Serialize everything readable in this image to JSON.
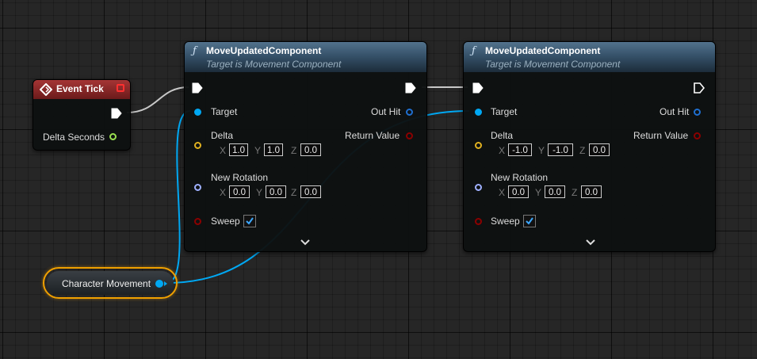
{
  "event_tick": {
    "title": "Event Tick",
    "output_label": "Delta Seconds"
  },
  "variable_node": {
    "label": "Character Movement"
  },
  "function_nodes": [
    {
      "title": "MoveUpdatedComponent",
      "subtitle": "Target is Movement Component",
      "target_label": "Target",
      "out_hit_label": "Out Hit",
      "return_label": "Return Value",
      "delta_label": "Delta",
      "delta": {
        "x": "1.0",
        "y": "1.0",
        "z": "0.0"
      },
      "rotation_label": "New Rotation",
      "rotation": {
        "x": "0.0",
        "y": "0.0",
        "z": "0.0"
      },
      "sweep_label": "Sweep",
      "sweep_checked": true
    },
    {
      "title": "MoveUpdatedComponent",
      "subtitle": "Target is Movement Component",
      "target_label": "Target",
      "out_hit_label": "Out Hit",
      "return_label": "Return Value",
      "delta_label": "Delta",
      "delta": {
        "x": "-1.0",
        "y": "-1.0",
        "z": "0.0"
      },
      "rotation_label": "New Rotation",
      "rotation": {
        "x": "0.0",
        "y": "0.0",
        "z": "0.0"
      },
      "sweep_label": "Sweep",
      "sweep_checked": true
    }
  ],
  "axis_labels": {
    "x": "X",
    "y": "Y",
    "z": "Z"
  },
  "icons": {
    "function": "ƒ",
    "event": "event-diamond-icon",
    "expand": "chevron-down-icon"
  },
  "colors": {
    "exec": "#ffffff",
    "object_pin": "#00a8f3",
    "vector_pin": "#e0b020",
    "rotator_pin": "#9fb0ff",
    "bool_pin": "#8b0000",
    "float_pin": "#9ae050",
    "struct_pin": "#1f6fd0",
    "event_header": "#a53535",
    "function_header": "#4a6a84",
    "selection": "#f0a000"
  }
}
